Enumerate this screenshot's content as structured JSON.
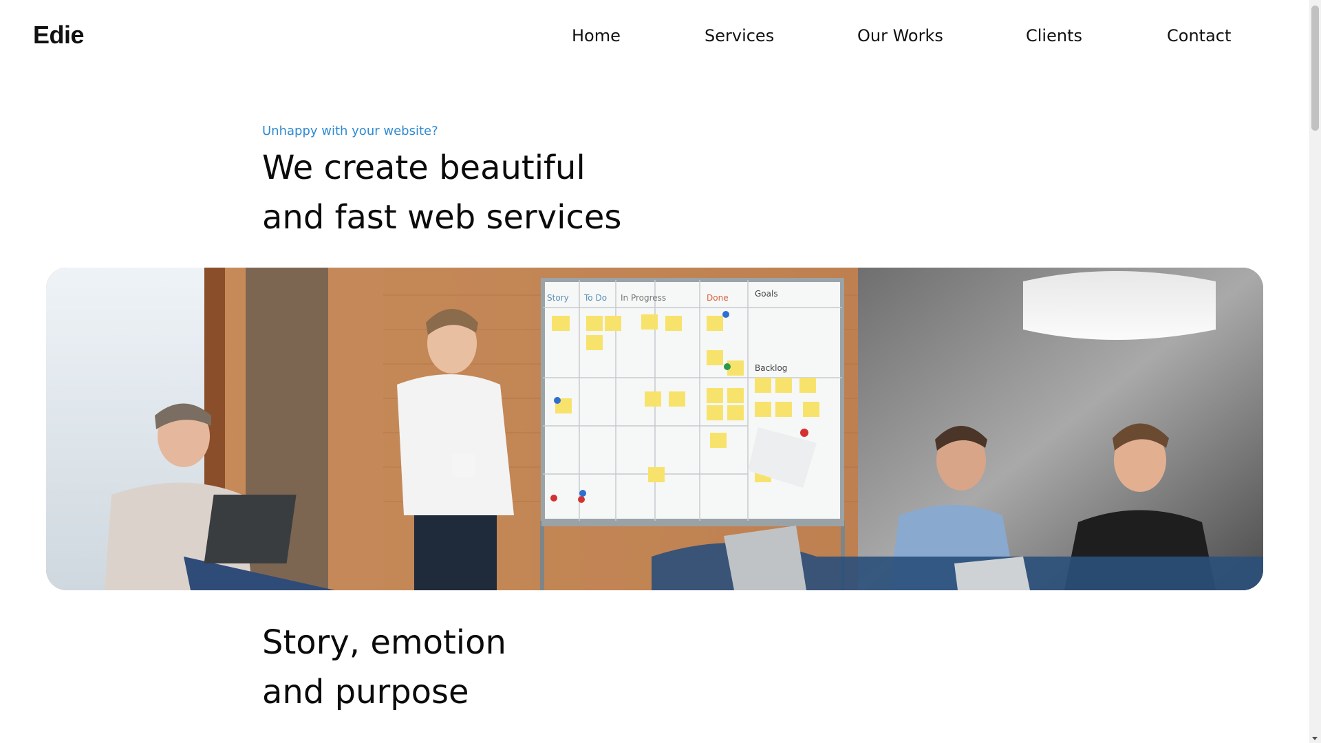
{
  "header": {
    "brand": "Edie",
    "nav": [
      {
        "label": "Home"
      },
      {
        "label": "Services"
      },
      {
        "label": "Our Works"
      },
      {
        "label": "Clients"
      },
      {
        "label": "Contact"
      }
    ]
  },
  "hero": {
    "eyebrow": "Unhappy with your website?",
    "headline_line1": "We create beautiful",
    "headline_line2": "and fast web services",
    "image_alt": "Team meeting in front of a whiteboard with sticky notes"
  },
  "whiteboard": {
    "columns": [
      "Story",
      "To Do",
      "In Progress",
      "Done",
      "Goals"
    ],
    "backlog": "Backlog"
  },
  "section": {
    "title_line1": "Story, emotion",
    "title_line2": "and purpose"
  },
  "colors": {
    "accent": "#2f8ad0",
    "text": "#111111",
    "background": "#ffffff"
  }
}
